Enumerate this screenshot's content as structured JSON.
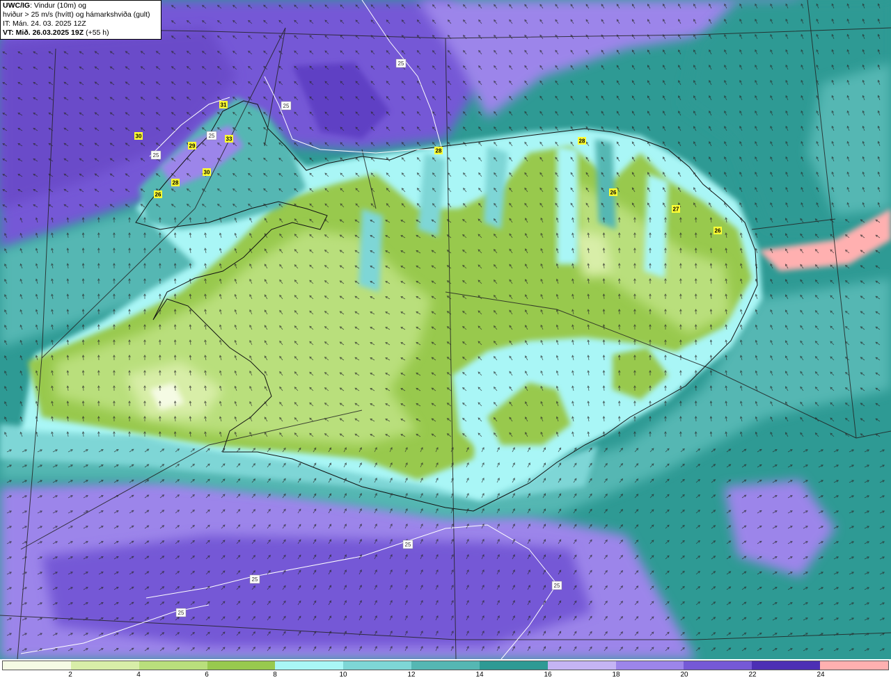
{
  "info": {
    "title_bold": "UWC/IG",
    "title_rest": ": Vindur (10m) og",
    "line2": "hviður > 25 m/s (hvítt) og hámarkshviða (gult)",
    "line3": "IT: Mán. 24. 03. 2025 12Z",
    "line4_bold": "VT: Mið. 26.03.2025 19Z",
    "line4_rest": " (+55 h)"
  },
  "legend": {
    "unit_ticks": [
      "2",
      "4",
      "6",
      "8",
      "10",
      "12",
      "14",
      "16",
      "18",
      "20",
      "22",
      "24"
    ],
    "colors": [
      "#f5fbe4",
      "#d8eea8",
      "#b9df7c",
      "#98c94e",
      "#a9f6f6",
      "#7ed6d6",
      "#55b7b3",
      "#2e9a94",
      "#c5b4f4",
      "#9c85ea",
      "#7559d6",
      "#4c2fb4",
      "#ffb0b0"
    ]
  },
  "gust_contour_value": "25",
  "gust_contour_labels": [
    {
      "text": "25"
    },
    {
      "text": "25"
    },
    {
      "text": "25"
    },
    {
      "text": "25"
    },
    {
      "text": "25"
    },
    {
      "text": "25"
    },
    {
      "text": "25"
    },
    {
      "text": "25"
    }
  ],
  "max_gust_labels": [
    {
      "text": "31"
    },
    {
      "text": "30"
    },
    {
      "text": "33"
    },
    {
      "text": "29"
    },
    {
      "text": "30"
    },
    {
      "text": "28"
    },
    {
      "text": "26"
    },
    {
      "text": "28"
    },
    {
      "text": "28"
    },
    {
      "text": "26"
    },
    {
      "text": "27"
    },
    {
      "text": "26"
    }
  ]
}
